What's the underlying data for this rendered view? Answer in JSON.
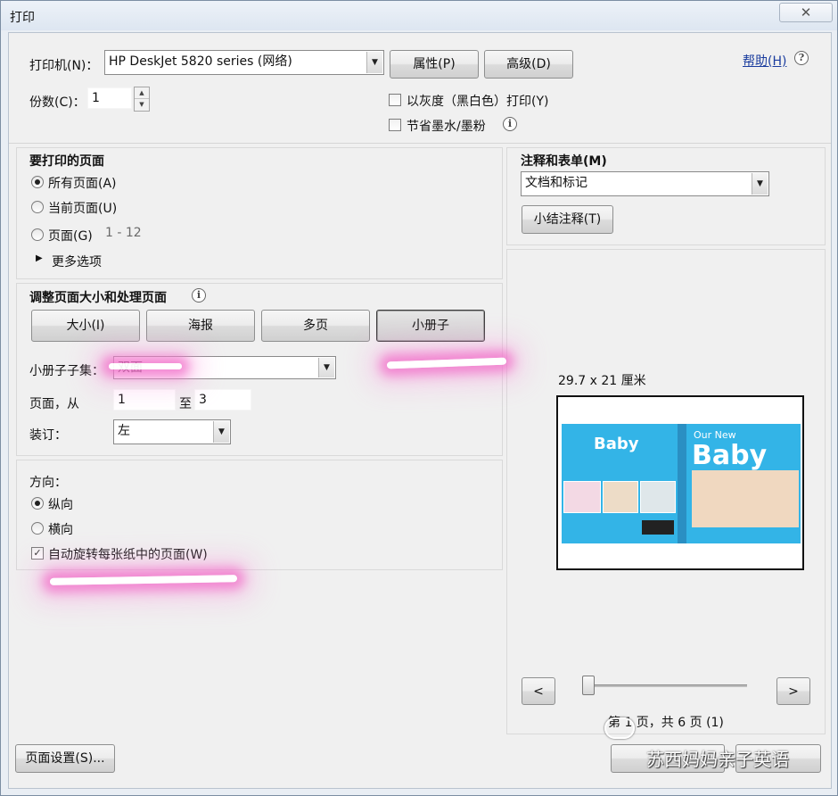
{
  "window": {
    "title": "打印",
    "close_icon": "close-icon"
  },
  "printer": {
    "label": "打印机(N)：",
    "selected": "HP DeskJet 5820 series (网络)",
    "properties_button": "属性(P)",
    "advanced_button": "高级(D)",
    "help_link": "帮助(H)",
    "copies_label": "份数(C)：",
    "copies_value": "1",
    "grayscale_label": "以灰度（黑白色）打印(Y)",
    "grayscale_checked": false,
    "save_ink_label": "节省墨水/墨粉",
    "save_ink_checked": false
  },
  "pages_to_print": {
    "heading": "要打印的页面",
    "options": [
      {
        "label": "所有页面(A)",
        "selected": true
      },
      {
        "label": "当前页面(U)",
        "selected": false
      },
      {
        "label": "页面(G)",
        "selected": false
      }
    ],
    "range_hint": "1 - 12",
    "more_options": "更多选项"
  },
  "page_handling": {
    "heading": "调整页面大小和处理页面",
    "buttons": [
      "大小(I)",
      "海报",
      "多页",
      "小册子"
    ],
    "active_button": "小册子",
    "subset_label": "小册子子集：",
    "subset_value": "双面",
    "pages_from_label": "页面，从",
    "pages_from_value": "1",
    "pages_to_label": "至",
    "pages_to_value": "3",
    "binding_label": "装订：",
    "binding_value": "左"
  },
  "orientation": {
    "heading": "方向：",
    "options": [
      {
        "label": "纵向",
        "selected": true
      },
      {
        "label": "横向",
        "selected": false
      }
    ],
    "auto_rotate_label": "自动旋转每张纸中的页面(W)",
    "auto_rotate_checked": true
  },
  "comments_forms": {
    "heading": "注释和表单(M)",
    "selected": "文档和标记",
    "summarize_button": "小结注释(T)"
  },
  "preview": {
    "size_text": "29.7 x 21 厘米",
    "book_left_title": "Baby",
    "book_right_line1": "Our New",
    "book_right_title": "Baby",
    "prev_button": "<",
    "next_button": ">",
    "page_status": "第 1 页，共 6 页 (1)"
  },
  "footer": {
    "page_setup_button": "页面设置(S)...",
    "watermark_text": "苏西妈妈亲子英语"
  },
  "colors": {
    "highlight_marker": "#f06ec8",
    "book_cover": "#33b4e7",
    "link": "#1a3c9e"
  }
}
